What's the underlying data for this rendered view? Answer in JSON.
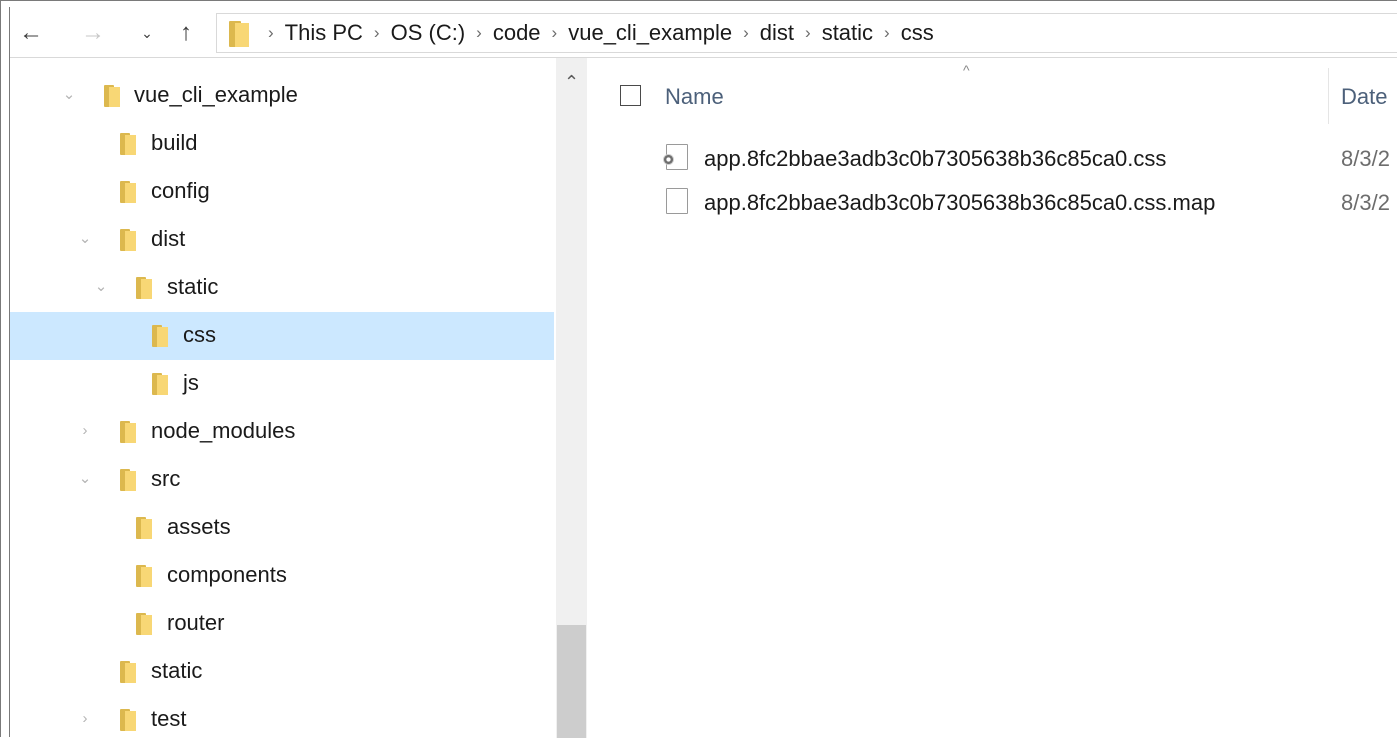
{
  "toolbar": {
    "back_icon": "arrow-left-icon",
    "back_glyph": "←",
    "forward_icon": "arrow-right-icon",
    "forward_glyph": "→",
    "recent_icon": "chevron-down-icon",
    "recent_glyph": "⌄",
    "up_icon": "arrow-up-icon",
    "up_glyph": "↑"
  },
  "breadcrumb": {
    "separator": "›",
    "items": [
      "This PC",
      "OS (C:)",
      "code",
      "vue_cli_example",
      "dist",
      "static",
      "css"
    ]
  },
  "nav_pane": {
    "items": [
      {
        "label": "vue_cli_example",
        "chevron": "⌄"
      },
      {
        "label": "build",
        "chevron": ""
      },
      {
        "label": "config",
        "chevron": ""
      },
      {
        "label": "dist",
        "chevron": "⌄"
      },
      {
        "label": "static",
        "chevron": "⌄"
      },
      {
        "label": "css",
        "chevron": "",
        "selected": true
      },
      {
        "label": "js",
        "chevron": ""
      },
      {
        "label": "node_modules",
        "chevron": "›"
      },
      {
        "label": "src",
        "chevron": "⌄"
      },
      {
        "label": "assets",
        "chevron": ""
      },
      {
        "label": "components",
        "chevron": ""
      },
      {
        "label": "router",
        "chevron": ""
      },
      {
        "label": "static",
        "chevron": ""
      },
      {
        "label": "test",
        "chevron": "›"
      }
    ],
    "scroll_up_glyph": "⌃"
  },
  "file_list": {
    "sort_glyph": "^",
    "columns": {
      "name": "Name",
      "date": "Date"
    },
    "files": [
      {
        "name": "app.8fc2bbae3adb3c0b7305638b36c85ca0.css",
        "date": "8/3/2",
        "icon": "css-file-icon"
      },
      {
        "name": "app.8fc2bbae3adb3c0b7305638b36c85ca0.css.map",
        "date": "8/3/2",
        "icon": "blank-file-icon"
      }
    ]
  },
  "colors": {
    "selection": "#cce8ff",
    "folder_front": "#f8d775",
    "folder_back": "#dcb84e",
    "header_text": "#4c607a"
  }
}
